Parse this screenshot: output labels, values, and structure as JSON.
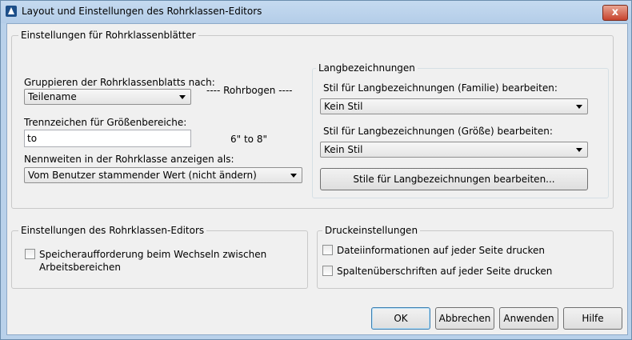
{
  "window": {
    "title": "Layout und Einstellungen des Rohrklassen-Editors",
    "close_label": "x"
  },
  "sheet_settings": {
    "legend": "Einstellungen für Rohrklassenblätter",
    "group_by_label": "Gruppieren der Rohrklassenblatts nach:",
    "group_by_value": "Teilename",
    "preview_heading": "---- Rohrbogen ----",
    "separator_label": "Trennzeichen für Größenbereiche:",
    "separator_value": "to",
    "separator_preview": "6\" to 8\"",
    "nominal_label": "Nennweiten in der Rohrklasse anzeigen als:",
    "nominal_value": "Vom Benutzer stammender Wert (nicht ändern)"
  },
  "long_desc": {
    "legend": "Langbezeichnungen",
    "family_label": "Stil für Langbezeichnungen (Familie) bearbeiten:",
    "family_value": "Kein Stil",
    "size_label": "Stil für Langbezeichnungen (Größe) bearbeiten:",
    "size_value": "Kein Stil",
    "edit_styles_button": "Stile für Langbezeichnungen bearbeiten..."
  },
  "editor_settings": {
    "legend": "Einstellungen des Rohrklassen-Editors",
    "save_prompt_line1": "Speicheraufforderung beim Wechseln zwischen",
    "save_prompt_line2": "Arbeitsbereichen",
    "save_prompt_checked": false
  },
  "print_settings": {
    "legend": "Druckeinstellungen",
    "file_info_label": "Dateiinformationen auf jeder Seite drucken",
    "file_info_checked": false,
    "column_headers_label": "Spaltenüberschriften auf jeder Seite drucken",
    "column_headers_checked": false
  },
  "buttons": {
    "ok": "OK",
    "cancel": "Abbrechen",
    "apply": "Anwenden",
    "help": "Hilfe"
  }
}
